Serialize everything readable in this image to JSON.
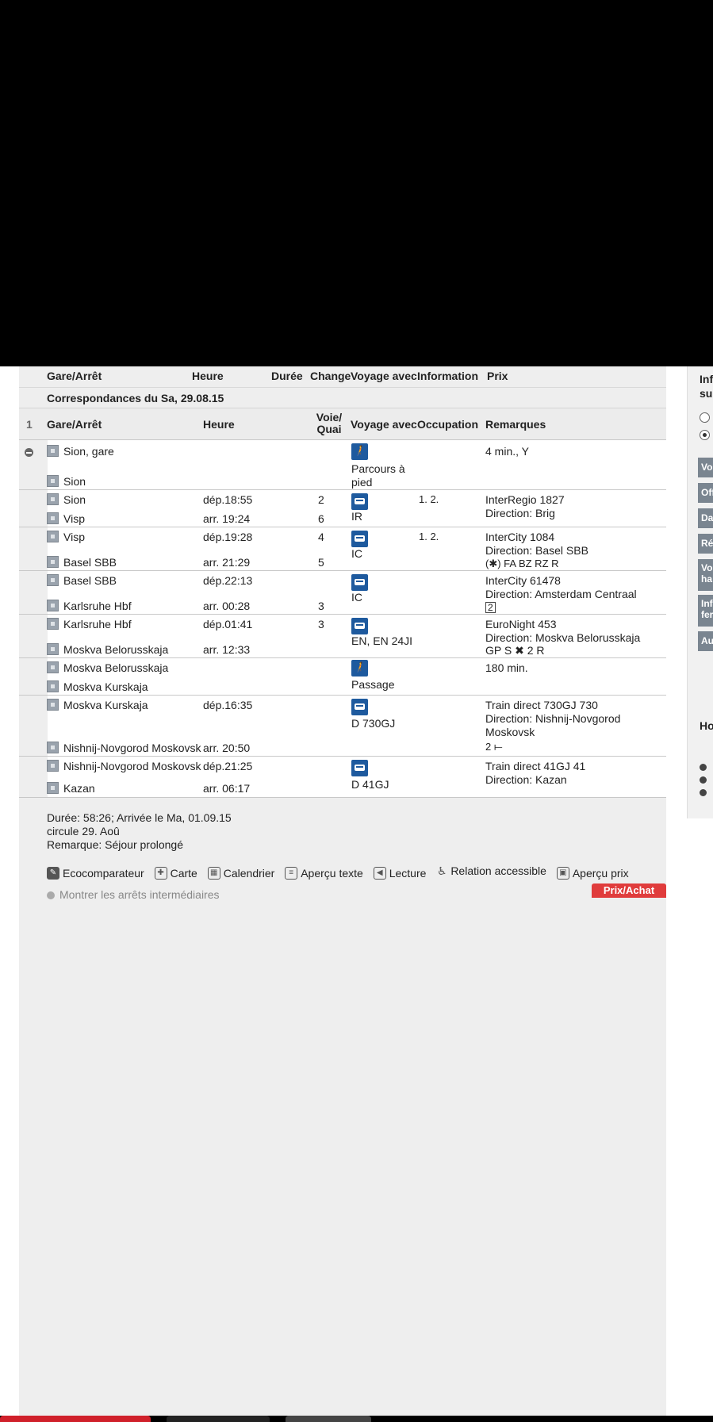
{
  "header": {
    "cols": [
      "Gare/Arrêt",
      "Heure",
      "Durée",
      "Change",
      "Voyage avec",
      "Information",
      "Prix"
    ],
    "connections_title": "Correspondances du Sa, 29.08.15"
  },
  "table_head": {
    "index": "1",
    "station": "Gare/Arrêt",
    "time": "Heure",
    "platform_1": "Voie/",
    "platform_2": "Quai",
    "voyage": "Voyage avec",
    "occupation": "Occupation",
    "remarks": "Remarques"
  },
  "rows": [
    {
      "dep_station": "Sion, gare",
      "arr_station": "Sion",
      "dep_time": "",
      "arr_time": "",
      "dep_track": "",
      "arr_track": "",
      "mode": "Parcours à pied",
      "occ": "",
      "rem1": "4 min., Y",
      "rem2": "",
      "rem3": ""
    },
    {
      "dep_station": "Sion",
      "arr_station": "Visp",
      "dep_time": "dép.18:55",
      "arr_time": "arr. 19:24",
      "dep_track": "2",
      "arr_track": "6",
      "mode": "IR",
      "occ": "1. 2.",
      "rem1": "InterRegio 1827",
      "rem2": "Direction: Brig",
      "rem3": ""
    },
    {
      "dep_station": "Visp",
      "arr_station": "Basel SBB",
      "dep_time": "dép.19:28",
      "arr_time": "arr. 21:29",
      "dep_track": "4",
      "arr_track": "5",
      "mode": "IC",
      "occ": "1. 2.",
      "rem1": "InterCity 1084",
      "rem2": "Direction: Basel SBB",
      "rem3": "(✱) FA BZ RZ R"
    },
    {
      "dep_station": "Basel SBB",
      "arr_station": "Karlsruhe Hbf",
      "dep_time": "dép.22:13",
      "arr_time": "arr. 00:28",
      "dep_track": "",
      "arr_track": "3",
      "mode": "IC",
      "occ": "",
      "rem1": "InterCity 61478",
      "rem2": "Direction: Amsterdam Centraal",
      "rem3": "2"
    },
    {
      "dep_station": "Karlsruhe Hbf",
      "arr_station": "Moskva Belorusskaja",
      "dep_time": "dép.01:41",
      "arr_time": "arr. 12:33",
      "dep_track": "3",
      "arr_track": "",
      "mode": "EN, EN 24JI",
      "occ": "",
      "rem1": "EuroNight 453",
      "rem2": "Direction: Moskva Belorusskaja",
      "rem3": "GP S ✖ 2 R"
    },
    {
      "dep_station": "Moskva Belorusskaja",
      "arr_station": "Moskva Kurskaja",
      "dep_time": "",
      "arr_time": "",
      "dep_track": "",
      "arr_track": "",
      "mode": "Passage",
      "occ": "",
      "rem1": "180 min.",
      "rem2": "",
      "rem3": ""
    },
    {
      "dep_station": "Moskva Kurskaja",
      "arr_station": "Nishnij-Novgorod Moskovsk",
      "dep_time": "dép.16:35",
      "arr_time": "arr. 20:50",
      "dep_track": "",
      "arr_track": "",
      "mode": "D 730GJ",
      "occ": "",
      "rem1": "Train direct 730GJ 730",
      "rem2": "Direction: Nishnij-Novgorod",
      "rem3": "Moskovsk",
      "rem4": "2 ⟝"
    },
    {
      "dep_station": "Nishnij-Novgorod Moskovsk",
      "arr_station": "Kazan",
      "dep_time": "dép.21:25",
      "arr_time": "arr. 06:17",
      "dep_track": "",
      "arr_track": "",
      "mode": "D 41GJ",
      "occ": "",
      "rem1": "Train direct 41GJ 41",
      "rem2": "Direction: Kazan",
      "rem3": ""
    }
  ],
  "summary": {
    "line1": "Durée: 58:26; Arrivée le Ma, 01.09.15",
    "line2": "circule 29. Aoû",
    "line3": "Remarque: Séjour prolongé"
  },
  "tools": [
    "Ecocomparateur",
    "Carte",
    "Calendrier",
    "Aperçu texte",
    "Lecture",
    "Relation accessible",
    "Aperçu prix"
  ],
  "show_stops": "Montrer les arrêts intermédiaires",
  "buy_label": "Prix/Achat",
  "sidebar": {
    "heading_1": "Inf",
    "heading_2": "su",
    "buttons": [
      "Vo",
      "Off",
      "Da",
      "Ré",
      "Vo ha",
      "Inf fer",
      "Au"
    ],
    "heading_3": "Ho"
  },
  "colors": {
    "accent": "#e03c3c",
    "icon_blue": "#1e5a9e",
    "panel": "#eeeeee"
  }
}
